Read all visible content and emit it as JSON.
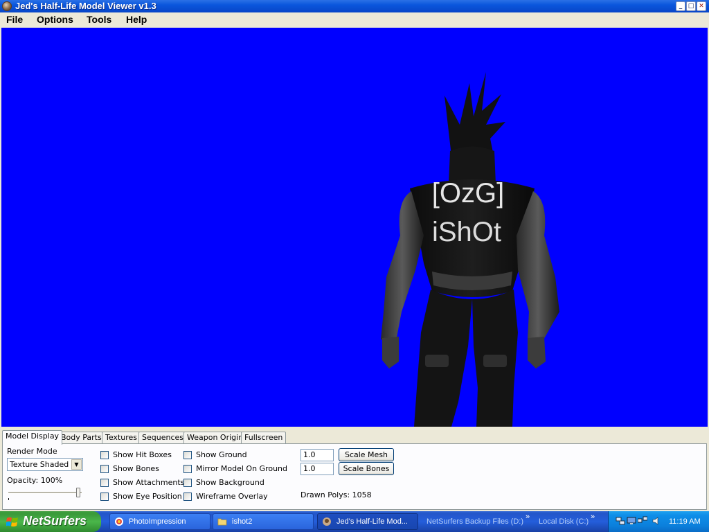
{
  "window": {
    "title": "Jed's Half-Life Model Viewer v1.3",
    "controls": {
      "minimize": "_",
      "maximize": "□",
      "close": "✕"
    }
  },
  "menu": [
    "File",
    "Options",
    "Tools",
    "Help"
  ],
  "viewport": {
    "background_color": "#0000FF",
    "model_text_line1": "[OzG]",
    "model_text_line2": "iShOt"
  },
  "tabs": [
    "Model Display",
    "Body Parts",
    "Textures",
    "Sequences",
    "Weapon Origin",
    "Fullscreen"
  ],
  "active_tab": "Model Display",
  "model_display": {
    "render_mode_label": "Render Mode",
    "render_mode_value": "Texture Shaded",
    "opacity_label": "Opacity: 100%",
    "opacity_percent": 100,
    "checkboxes_col1": [
      "Show Hit Boxes",
      "Show Bones",
      "Show Attachments",
      "Show Eye Position"
    ],
    "checkboxes_col2": [
      "Show Ground",
      "Mirror Model On Ground",
      "Show Background",
      "Wireframe Overlay"
    ],
    "scale_mesh_value": "1.0",
    "scale_bones_value": "1.0",
    "scale_mesh_button": "Scale Mesh",
    "scale_bones_button": "Scale Bones",
    "drawn_polys": "Drawn Polys: 1058"
  },
  "taskbar": {
    "start_label": "NetSurfers",
    "buttons": [
      {
        "label": "PhotoImpression",
        "icon": "photoimpression-icon",
        "active": false
      },
      {
        "label": "ishot2",
        "icon": "folder-icon",
        "active": false
      },
      {
        "label": "Jed's Half-Life Mod...",
        "icon": "hlmv-icon",
        "active": true
      }
    ],
    "links": [
      "NetSurfers Backup Files (D:)",
      "Local Disk (C:)"
    ],
    "chevron": "»",
    "clock": "11:19 AM",
    "tray_icons": [
      "network-icon",
      "display-icon",
      "network-connections-icon",
      "volume-icon"
    ]
  }
}
